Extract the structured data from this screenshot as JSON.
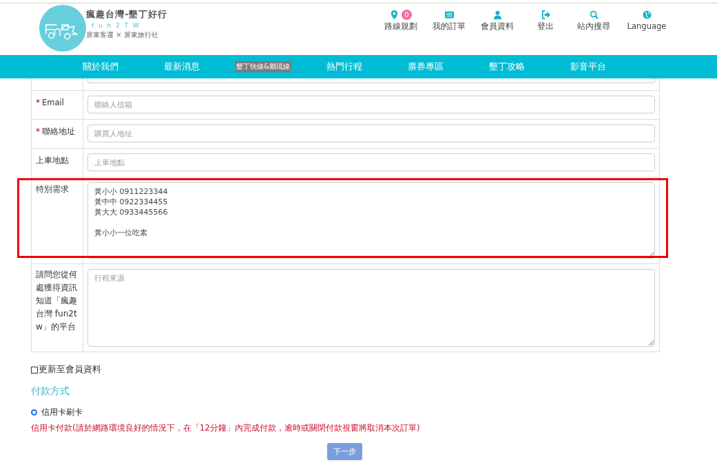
{
  "header": {
    "brand": {
      "title": "瘋趣台灣-墾丁好行",
      "subtitle": "f u n 2 T W",
      "tagline": "屏東客運 × 屏東旅行社"
    },
    "top_links": [
      {
        "kind": "pin",
        "label": "路線規劃",
        "badge": "0"
      },
      {
        "kind": "list",
        "label": "我的訂單"
      },
      {
        "kind": "user",
        "label": "會員資料"
      },
      {
        "kind": "logout",
        "label": "登出"
      },
      {
        "kind": "search",
        "label": "站內搜尋"
      },
      {
        "kind": "globe",
        "label": "Language"
      }
    ],
    "nav": [
      {
        "label": "關於我們",
        "kind": "link"
      },
      {
        "label": "最新消息",
        "kind": "link"
      },
      {
        "label": "墾丁快線&鵝琉線",
        "kind": "tag"
      },
      {
        "label": "熱門行程",
        "kind": "link"
      },
      {
        "label": "票券專區",
        "kind": "link"
      },
      {
        "label": "墾丁攻略",
        "kind": "link"
      },
      {
        "label": "影音平台",
        "kind": "link"
      }
    ]
  },
  "form": {
    "rows": [
      {
        "marker": "*",
        "label": "Email",
        "kind": "input",
        "placeholder": "聯絡人信箱",
        "highlighted": false
      },
      {
        "marker": "*",
        "label": "聯絡地址",
        "kind": "input",
        "placeholder": "購買人地址",
        "highlighted": false
      },
      {
        "label": "上車地點",
        "kind": "input",
        "placeholder": "上車地點",
        "highlighted": false
      },
      {
        "label": "特別需求",
        "kind": "textarea",
        "value": "黃小小 0911223344\n黃中中 0922334455\n黃大大 0933445566\n\n黃小小一位吃素",
        "highlighted": true
      },
      {
        "label": "請問您從何處獲得資訊知道「瘋趣台灣 fun2tw」的平台",
        "kind": "tall",
        "placeholder": "行程來源",
        "highlighted": false
      }
    ]
  },
  "update_member": {
    "label": "更新至會員資料",
    "checked": false
  },
  "payment": {
    "title": "付款方式",
    "options": [
      {
        "label": "信用卡刷卡",
        "selected": true
      }
    ],
    "note": "信用卡付款(請於網路環境良好的情況下，在「12分鐘」內完成付款，逾時或關閉付款視窗將取消本次訂單)",
    "submit": "下一步"
  }
}
